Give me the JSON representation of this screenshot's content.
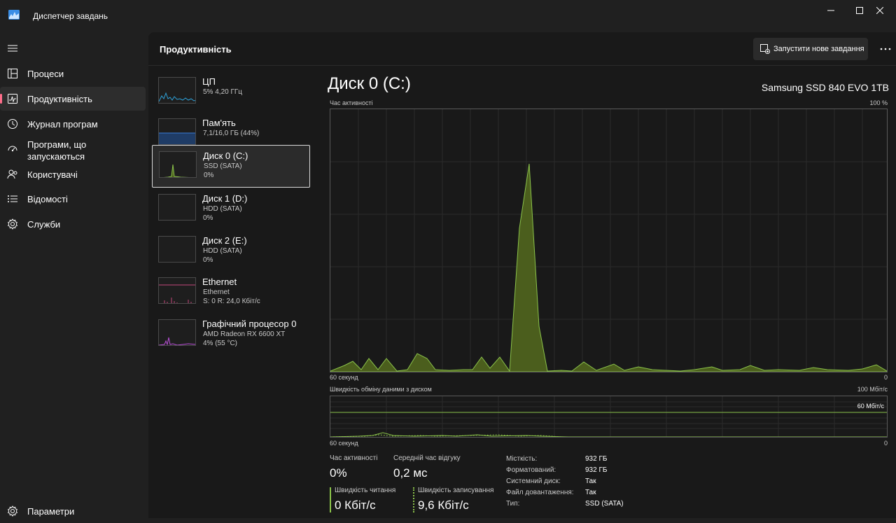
{
  "app": {
    "title": "Диспетчер завдань"
  },
  "nav": {
    "items": [
      {
        "label": "Процеси"
      },
      {
        "label": "Продуктивність"
      },
      {
        "label": "Журнал програм"
      },
      {
        "label": "Програми, що запускаються"
      },
      {
        "label": "Користувачі"
      },
      {
        "label": "Відомості"
      },
      {
        "label": "Служби"
      }
    ],
    "settings": "Параметри"
  },
  "header": {
    "title": "Продуктивність",
    "run_task": "Запустити нове завдання"
  },
  "devices": [
    {
      "name": "ЦП",
      "sub1": "5%  4,20 ГГц",
      "sub2": ""
    },
    {
      "name": "Пам'ять",
      "sub1": "7,1/16,0 ГБ (44%)",
      "sub2": ""
    },
    {
      "name": "Диск 0 (C:)",
      "sub1": "SSD (SATA)",
      "sub2": "0%"
    },
    {
      "name": "Диск 1 (D:)",
      "sub1": "HDD (SATA)",
      "sub2": "0%"
    },
    {
      "name": "Диск 2 (E:)",
      "sub1": "HDD (SATA)",
      "sub2": "0%"
    },
    {
      "name": "Ethernet",
      "sub1": "Ethernet",
      "sub2": "S: 0 R: 24,0 Кбіт/с"
    },
    {
      "name": "Графічний процесор 0",
      "sub1": "AMD Radeon RX 6600 XT",
      "sub2": "4% (55 °C)"
    }
  ],
  "detail": {
    "title": "Диск 0 (C:)",
    "model": "Samsung SSD 840 EVO 1TB",
    "activity_label": "Час активності",
    "activity_max": "100 %",
    "time_left": "60 секунд",
    "time_right": "0",
    "transfer_label": "Швидкість обміну даними з диском",
    "transfer_max": "100 Мбіт/с",
    "transfer_line": "60 Мбіт/с",
    "time_left2": "60 секунд",
    "time_right2": "0"
  },
  "stats": {
    "active_time_label": "Час активності",
    "active_time_value": "0%",
    "avg_response_label": "Середній час відгуку",
    "avg_response_value": "0,2 мс",
    "read_label": "Швидкість читання",
    "read_value": "0 Кбіт/с",
    "write_label": "Швидкість записування",
    "write_value": "9,6 Кбіт/с"
  },
  "props": [
    {
      "k": "Місткість:",
      "v": "932 ГБ"
    },
    {
      "k": "Форматований:",
      "v": "932 ГБ"
    },
    {
      "k": "Системний диск:",
      "v": "Так"
    },
    {
      "k": "Файл довантаження:",
      "v": "Так"
    },
    {
      "k": "Тип:",
      "v": "SSD (SATA)"
    }
  ],
  "colors": {
    "accent": "#ff6d8a",
    "disk": "#8bc34a",
    "disk_fill": "#4b5e1d"
  }
}
